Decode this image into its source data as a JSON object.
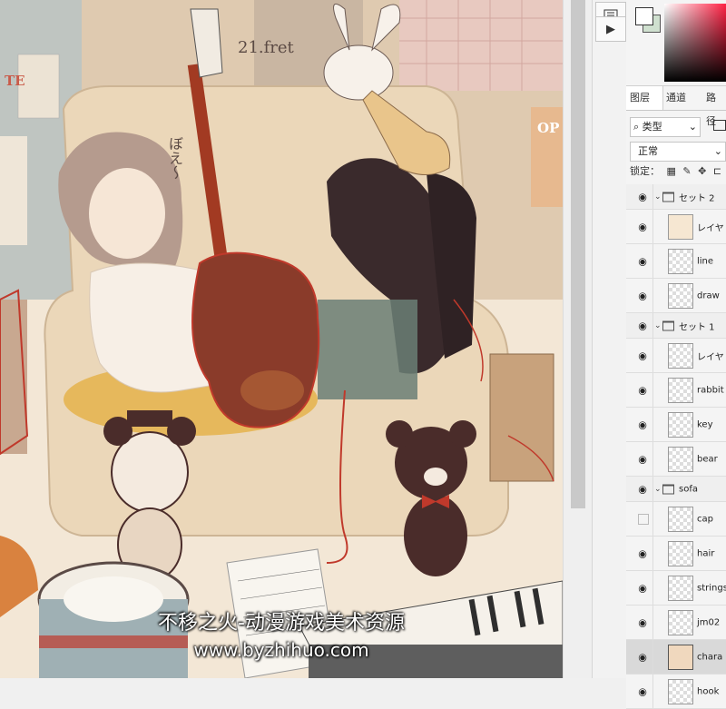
{
  "canvas": {
    "fret_text": "21.fret",
    "sofa_text": "ぼえ～",
    "sign_left": "TE",
    "sign_right": "OP"
  },
  "watermark": {
    "line1": "不移之火-动漫游戏美术资源",
    "line2": "www.byzhihuo.com"
  },
  "toolbar": {
    "play_icon": "play-icon"
  },
  "panel": {
    "tabs": [
      "图层",
      "通道",
      "路径"
    ],
    "filter_label": "类型",
    "blend_mode": "正常",
    "lock_label": "锁定："
  },
  "layers": [
    {
      "type": "group",
      "name": "セット 2",
      "visible": true
    },
    {
      "type": "layer",
      "name": "レイヤ",
      "thumb": "paper",
      "visible": true
    },
    {
      "type": "layer",
      "name": "line",
      "thumb": "empty",
      "visible": true
    },
    {
      "type": "layer",
      "name": "draw",
      "thumb": "empty",
      "visible": true
    },
    {
      "type": "group",
      "name": "セット 1",
      "visible": true
    },
    {
      "type": "layer",
      "name": "レイヤ",
      "thumb": "empty",
      "visible": true
    },
    {
      "type": "layer",
      "name": "rabbit",
      "thumb": "empty",
      "visible": true
    },
    {
      "type": "layer",
      "name": "key",
      "thumb": "empty",
      "visible": true
    },
    {
      "type": "layer",
      "name": "bear",
      "thumb": "empty",
      "visible": true
    },
    {
      "type": "group",
      "name": "sofa",
      "visible": true
    },
    {
      "type": "layer",
      "name": "cap",
      "thumb": "empty",
      "visible": false
    },
    {
      "type": "layer",
      "name": "hair",
      "thumb": "empty",
      "visible": true
    },
    {
      "type": "layer",
      "name": "strings",
      "thumb": "empty",
      "visible": true
    },
    {
      "type": "layer",
      "name": "jm02",
      "thumb": "empty",
      "visible": true
    },
    {
      "type": "layer",
      "name": "chara",
      "thumb": "chara",
      "visible": true,
      "selected": true
    },
    {
      "type": "layer",
      "name": "hook",
      "thumb": "empty",
      "visible": true
    }
  ],
  "colors": {
    "canvas_bg": "#ead8c4",
    "sofa": "#e8d2b3",
    "guitar_body": "#8a3b2a",
    "outline": "#c0392b",
    "bear": "#4a2c2a"
  }
}
